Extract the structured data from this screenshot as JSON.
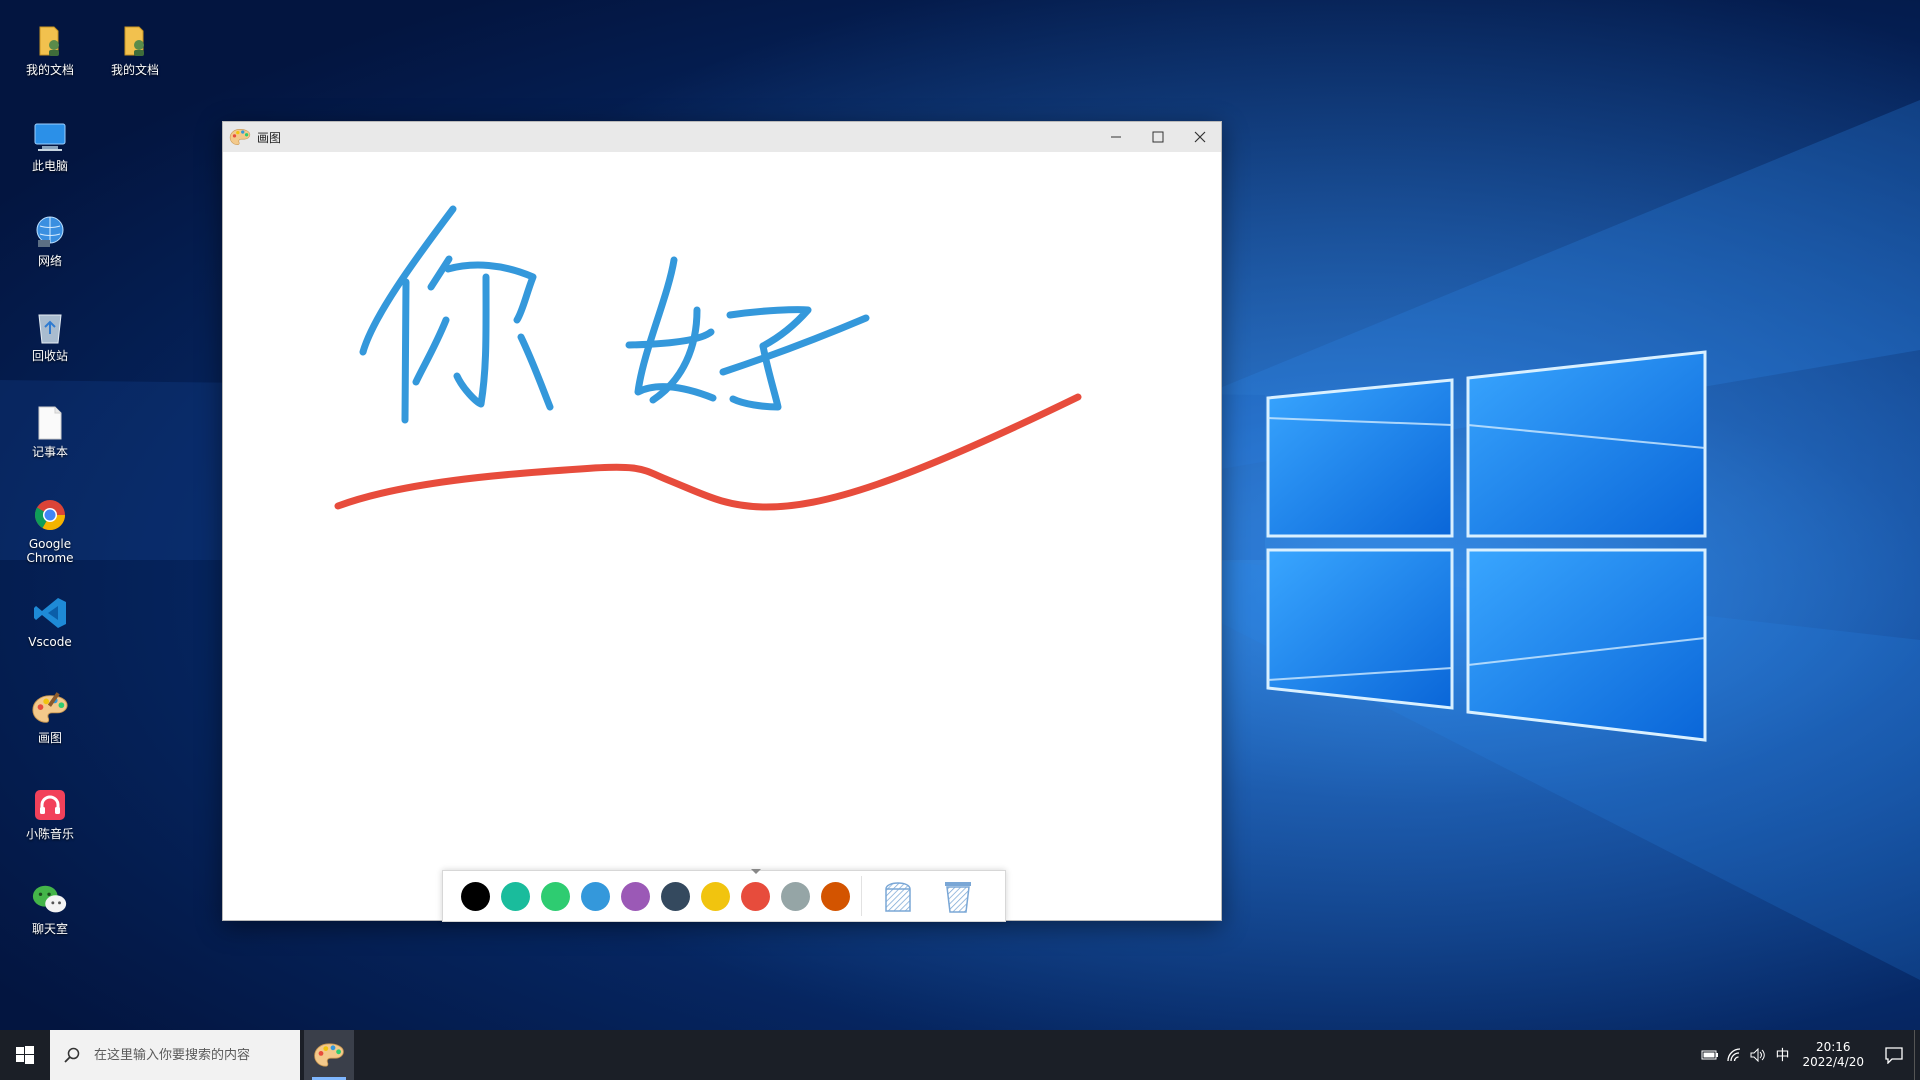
{
  "desktop": {
    "icons": [
      {
        "label": "我的文档"
      },
      {
        "label": "我的文档"
      },
      {
        "label": "此电脑"
      },
      {
        "label": "网络"
      },
      {
        "label": "回收站"
      },
      {
        "label": "记事本"
      },
      {
        "label": "Google\nChrome"
      },
      {
        "label": "Vscode"
      },
      {
        "label": "画图"
      },
      {
        "label": "小陈音乐"
      },
      {
        "label": "聊天室"
      }
    ]
  },
  "window": {
    "title": "画图",
    "controls": [
      "minimize",
      "maximize",
      "close"
    ],
    "drawing": {
      "strokes": [
        {
          "color": "#3498db",
          "meaning": "你好 handwritten"
        },
        {
          "color": "#e74c3c",
          "meaning": "underline wave"
        }
      ]
    },
    "palette": {
      "colors": [
        "#000000",
        "#1abc9c",
        "#2ecc71",
        "#3498db",
        "#9b59b6",
        "#34495e",
        "#f1c40f",
        "#e74c3c",
        "#95a5a6",
        "#d35400"
      ],
      "selected_index": 7,
      "tools": [
        "eraser-icon",
        "trash-icon"
      ]
    }
  },
  "taskbar": {
    "search_placeholder": "在这里输入你要搜索的内容",
    "pinned_app": "画图",
    "tray": {
      "ime": "中",
      "time": "20:16",
      "date": "2022/4/20"
    }
  }
}
